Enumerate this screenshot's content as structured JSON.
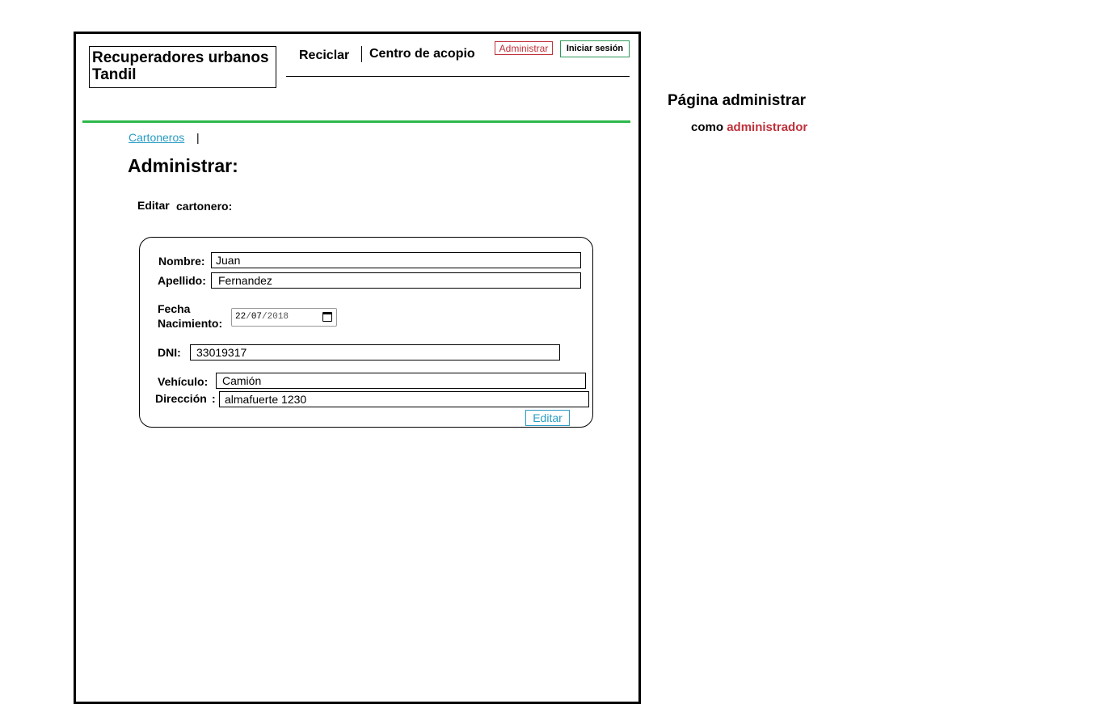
{
  "header": {
    "logo_line1": "Recuperadores urbanos",
    "logo_line2": "Tandil",
    "nav": [
      "Reciclar",
      "Centro de acopio"
    ],
    "admin_button": "Administrar",
    "login_button": "Iniciar sesión"
  },
  "breadcrumb": {
    "link": "Cartoneros",
    "separator": "|"
  },
  "page": {
    "title": "Administrar:",
    "subtitle_a": "Editar",
    "subtitle_b": "cartonero:"
  },
  "form": {
    "nombre_label": "Nombre:",
    "nombre_value": "Juan",
    "apellido_label": "Apellido:",
    "apellido_value": "Fernandez",
    "fecha_label_1": "Fecha",
    "fecha_label_2": "Nacimiento:",
    "fecha_dd": "22",
    "fecha_mm": "07",
    "fecha_yyyy": "2018",
    "dni_label": "DNI:",
    "dni_value": "33019317",
    "vehiculo_label": "Vehículo:",
    "vehiculo_value": "Camión",
    "direccion_label": "Dirección",
    "direccion_colon": ":",
    "direccion_value": "almafuerte 1230",
    "submit_label": "Editar"
  },
  "annotation": {
    "title": "Página administrar",
    "prefix": "como",
    "role": "administrador"
  },
  "colors": {
    "accent_red": "#c0303a",
    "accent_green": "#2db84a",
    "link_blue": "#2a9bc4"
  }
}
